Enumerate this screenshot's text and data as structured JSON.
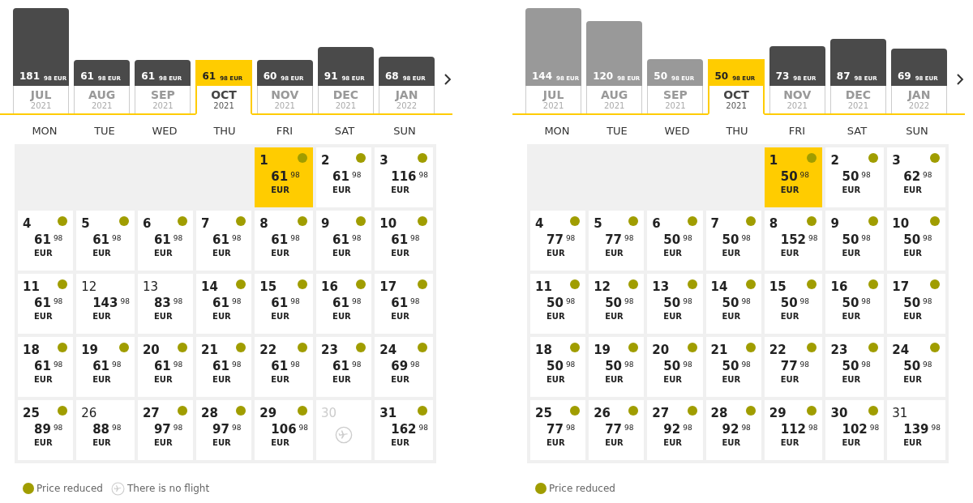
{
  "calendars": [
    {
      "months": [
        {
          "price": "181",
          "cents": "98 EUR",
          "month": "JUL",
          "year": "2021",
          "greyed": false,
          "selected": false
        },
        {
          "price": "61",
          "cents": "98 EUR",
          "month": "AUG",
          "year": "2021",
          "greyed": false,
          "selected": false
        },
        {
          "price": "61",
          "cents": "98 EUR",
          "month": "SEP",
          "year": "2021",
          "greyed": false,
          "selected": false
        },
        {
          "price": "61",
          "cents": "98 EUR",
          "month": "OCT",
          "year": "2021",
          "greyed": false,
          "selected": true
        },
        {
          "price": "60",
          "cents": "98 EUR",
          "month": "NOV",
          "year": "2021",
          "greyed": false,
          "selected": false
        },
        {
          "price": "91",
          "cents": "98 EUR",
          "month": "DEC",
          "year": "2021",
          "greyed": false,
          "selected": false
        },
        {
          "price": "68",
          "cents": "98 EUR",
          "month": "JAN",
          "year": "2022",
          "greyed": false,
          "selected": false
        }
      ],
      "weekdays": [
        "MON",
        "TUE",
        "WED",
        "THU",
        "FRI",
        "SAT",
        "SUN"
      ],
      "weeks": [
        [
          {
            "kind": "flight",
            "day": "1",
            "price": "61",
            "cents": "98",
            "currency": "EUR",
            "reduced": true,
            "selected": true
          },
          {
            "kind": "flight",
            "day": "2",
            "price": "61",
            "cents": "98",
            "currency": "EUR",
            "reduced": true,
            "selected": false
          },
          {
            "kind": "flight",
            "day": "3",
            "price": "116",
            "cents": "98",
            "currency": "EUR",
            "reduced": true,
            "selected": false
          }
        ],
        [
          {
            "kind": "flight",
            "day": "4",
            "price": "61",
            "cents": "98",
            "currency": "EUR",
            "reduced": true,
            "selected": false
          },
          {
            "kind": "flight",
            "day": "5",
            "price": "61",
            "cents": "98",
            "currency": "EUR",
            "reduced": true,
            "selected": false
          },
          {
            "kind": "flight",
            "day": "6",
            "price": "61",
            "cents": "98",
            "currency": "EUR",
            "reduced": true,
            "selected": false
          },
          {
            "kind": "flight",
            "day": "7",
            "price": "61",
            "cents": "98",
            "currency": "EUR",
            "reduced": true,
            "selected": false
          },
          {
            "kind": "flight",
            "day": "8",
            "price": "61",
            "cents": "98",
            "currency": "EUR",
            "reduced": true,
            "selected": false
          },
          {
            "kind": "flight",
            "day": "9",
            "price": "61",
            "cents": "98",
            "currency": "EUR",
            "reduced": true,
            "selected": false
          },
          {
            "kind": "flight",
            "day": "10",
            "price": "61",
            "cents": "98",
            "currency": "EUR",
            "reduced": true,
            "selected": false
          }
        ],
        [
          {
            "kind": "flight",
            "day": "11",
            "price": "61",
            "cents": "98",
            "currency": "EUR",
            "reduced": true,
            "selected": false
          },
          {
            "kind": "flight",
            "day": "12",
            "price": "143",
            "cents": "98",
            "currency": "EUR",
            "reduced": false,
            "selected": false
          },
          {
            "kind": "flight",
            "day": "13",
            "price": "83",
            "cents": "98",
            "currency": "EUR",
            "reduced": false,
            "selected": false
          },
          {
            "kind": "flight",
            "day": "14",
            "price": "61",
            "cents": "98",
            "currency": "EUR",
            "reduced": true,
            "selected": false
          },
          {
            "kind": "flight",
            "day": "15",
            "price": "61",
            "cents": "98",
            "currency": "EUR",
            "reduced": true,
            "selected": false
          },
          {
            "kind": "flight",
            "day": "16",
            "price": "61",
            "cents": "98",
            "currency": "EUR",
            "reduced": true,
            "selected": false
          },
          {
            "kind": "flight",
            "day": "17",
            "price": "61",
            "cents": "98",
            "currency": "EUR",
            "reduced": true,
            "selected": false
          }
        ],
        [
          {
            "kind": "flight",
            "day": "18",
            "price": "61",
            "cents": "98",
            "currency": "EUR",
            "reduced": true,
            "selected": false
          },
          {
            "kind": "flight",
            "day": "19",
            "price": "61",
            "cents": "98",
            "currency": "EUR",
            "reduced": true,
            "selected": false
          },
          {
            "kind": "flight",
            "day": "20",
            "price": "61",
            "cents": "98",
            "currency": "EUR",
            "reduced": true,
            "selected": false
          },
          {
            "kind": "flight",
            "day": "21",
            "price": "61",
            "cents": "98",
            "currency": "EUR",
            "reduced": true,
            "selected": false
          },
          {
            "kind": "flight",
            "day": "22",
            "price": "61",
            "cents": "98",
            "currency": "EUR",
            "reduced": true,
            "selected": false
          },
          {
            "kind": "flight",
            "day": "23",
            "price": "61",
            "cents": "98",
            "currency": "EUR",
            "reduced": true,
            "selected": false
          },
          {
            "kind": "flight",
            "day": "24",
            "price": "69",
            "cents": "98",
            "currency": "EUR",
            "reduced": true,
            "selected": false
          }
        ],
        [
          {
            "kind": "flight",
            "day": "25",
            "price": "89",
            "cents": "98",
            "currency": "EUR",
            "reduced": true,
            "selected": false
          },
          {
            "kind": "flight",
            "day": "26",
            "price": "88",
            "cents": "98",
            "currency": "EUR",
            "reduced": false,
            "selected": false
          },
          {
            "kind": "flight",
            "day": "27",
            "price": "97",
            "cents": "98",
            "currency": "EUR",
            "reduced": true,
            "selected": false
          },
          {
            "kind": "flight",
            "day": "28",
            "price": "97",
            "cents": "98",
            "currency": "EUR",
            "reduced": true,
            "selected": false
          },
          {
            "kind": "flight",
            "day": "29",
            "price": "106",
            "cents": "98",
            "currency": "EUR",
            "reduced": true,
            "selected": false
          },
          {
            "kind": "no_flight",
            "day": "30"
          },
          {
            "kind": "flight",
            "day": "31",
            "price": "162",
            "cents": "98",
            "currency": "EUR",
            "reduced": true,
            "selected": false
          }
        ]
      ],
      "legend": [
        {
          "kind": "reduced",
          "label": "Price reduced"
        },
        {
          "kind": "no_flight",
          "label": "There is no flight"
        }
      ]
    },
    {
      "months": [
        {
          "price": "144",
          "cents": "98 EUR",
          "month": "JUL",
          "year": "2021",
          "greyed": true,
          "selected": false
        },
        {
          "price": "120",
          "cents": "98 EUR",
          "month": "AUG",
          "year": "2021",
          "greyed": true,
          "selected": false
        },
        {
          "price": "50",
          "cents": "98 EUR",
          "month": "SEP",
          "year": "2021",
          "greyed": true,
          "selected": false
        },
        {
          "price": "50",
          "cents": "98 EUR",
          "month": "OCT",
          "year": "2021",
          "greyed": false,
          "selected": true
        },
        {
          "price": "73",
          "cents": "98 EUR",
          "month": "NOV",
          "year": "2021",
          "greyed": false,
          "selected": false
        },
        {
          "price": "87",
          "cents": "98 EUR",
          "month": "DEC",
          "year": "2021",
          "greyed": false,
          "selected": false
        },
        {
          "price": "69",
          "cents": "98 EUR",
          "month": "JAN",
          "year": "2022",
          "greyed": false,
          "selected": false
        }
      ],
      "weekdays": [
        "MON",
        "TUE",
        "WED",
        "THU",
        "FRI",
        "SAT",
        "SUN"
      ],
      "weeks": [
        [
          {
            "kind": "flight",
            "day": "1",
            "price": "50",
            "cents": "98",
            "currency": "EUR",
            "reduced": true,
            "selected": true
          },
          {
            "kind": "flight",
            "day": "2",
            "price": "50",
            "cents": "98",
            "currency": "EUR",
            "reduced": true,
            "selected": false
          },
          {
            "kind": "flight",
            "day": "3",
            "price": "62",
            "cents": "98",
            "currency": "EUR",
            "reduced": true,
            "selected": false
          }
        ],
        [
          {
            "kind": "flight",
            "day": "4",
            "price": "77",
            "cents": "98",
            "currency": "EUR",
            "reduced": true,
            "selected": false
          },
          {
            "kind": "flight",
            "day": "5",
            "price": "77",
            "cents": "98",
            "currency": "EUR",
            "reduced": true,
            "selected": false
          },
          {
            "kind": "flight",
            "day": "6",
            "price": "50",
            "cents": "98",
            "currency": "EUR",
            "reduced": true,
            "selected": false
          },
          {
            "kind": "flight",
            "day": "7",
            "price": "50",
            "cents": "98",
            "currency": "EUR",
            "reduced": true,
            "selected": false
          },
          {
            "kind": "flight",
            "day": "8",
            "price": "152",
            "cents": "98",
            "currency": "EUR",
            "reduced": true,
            "selected": false
          },
          {
            "kind": "flight",
            "day": "9",
            "price": "50",
            "cents": "98",
            "currency": "EUR",
            "reduced": true,
            "selected": false
          },
          {
            "kind": "flight",
            "day": "10",
            "price": "50",
            "cents": "98",
            "currency": "EUR",
            "reduced": true,
            "selected": false
          }
        ],
        [
          {
            "kind": "flight",
            "day": "11",
            "price": "50",
            "cents": "98",
            "currency": "EUR",
            "reduced": true,
            "selected": false
          },
          {
            "kind": "flight",
            "day": "12",
            "price": "50",
            "cents": "98",
            "currency": "EUR",
            "reduced": true,
            "selected": false
          },
          {
            "kind": "flight",
            "day": "13",
            "price": "50",
            "cents": "98",
            "currency": "EUR",
            "reduced": true,
            "selected": false
          },
          {
            "kind": "flight",
            "day": "14",
            "price": "50",
            "cents": "98",
            "currency": "EUR",
            "reduced": true,
            "selected": false
          },
          {
            "kind": "flight",
            "day": "15",
            "price": "50",
            "cents": "98",
            "currency": "EUR",
            "reduced": true,
            "selected": false
          },
          {
            "kind": "flight",
            "day": "16",
            "price": "50",
            "cents": "98",
            "currency": "EUR",
            "reduced": true,
            "selected": false
          },
          {
            "kind": "flight",
            "day": "17",
            "price": "50",
            "cents": "98",
            "currency": "EUR",
            "reduced": true,
            "selected": false
          }
        ],
        [
          {
            "kind": "flight",
            "day": "18",
            "price": "50",
            "cents": "98",
            "currency": "EUR",
            "reduced": true,
            "selected": false
          },
          {
            "kind": "flight",
            "day": "19",
            "price": "50",
            "cents": "98",
            "currency": "EUR",
            "reduced": true,
            "selected": false
          },
          {
            "kind": "flight",
            "day": "20",
            "price": "50",
            "cents": "98",
            "currency": "EUR",
            "reduced": true,
            "selected": false
          },
          {
            "kind": "flight",
            "day": "21",
            "price": "50",
            "cents": "98",
            "currency": "EUR",
            "reduced": true,
            "selected": false
          },
          {
            "kind": "flight",
            "day": "22",
            "price": "77",
            "cents": "98",
            "currency": "EUR",
            "reduced": true,
            "selected": false
          },
          {
            "kind": "flight",
            "day": "23",
            "price": "50",
            "cents": "98",
            "currency": "EUR",
            "reduced": true,
            "selected": false
          },
          {
            "kind": "flight",
            "day": "24",
            "price": "50",
            "cents": "98",
            "currency": "EUR",
            "reduced": true,
            "selected": false
          }
        ],
        [
          {
            "kind": "flight",
            "day": "25",
            "price": "77",
            "cents": "98",
            "currency": "EUR",
            "reduced": true,
            "selected": false
          },
          {
            "kind": "flight",
            "day": "26",
            "price": "77",
            "cents": "98",
            "currency": "EUR",
            "reduced": true,
            "selected": false
          },
          {
            "kind": "flight",
            "day": "27",
            "price": "92",
            "cents": "98",
            "currency": "EUR",
            "reduced": true,
            "selected": false
          },
          {
            "kind": "flight",
            "day": "28",
            "price": "92",
            "cents": "98",
            "currency": "EUR",
            "reduced": true,
            "selected": false
          },
          {
            "kind": "flight",
            "day": "29",
            "price": "112",
            "cents": "98",
            "currency": "EUR",
            "reduced": true,
            "selected": false
          },
          {
            "kind": "flight",
            "day": "30",
            "price": "102",
            "cents": "98",
            "currency": "EUR",
            "reduced": true,
            "selected": false
          },
          {
            "kind": "flight",
            "day": "31",
            "price": "139",
            "cents": "98",
            "currency": "EUR",
            "reduced": false,
            "selected": false
          }
        ]
      ],
      "legend": [
        {
          "kind": "reduced",
          "label": "Price reduced"
        }
      ]
    }
  ]
}
